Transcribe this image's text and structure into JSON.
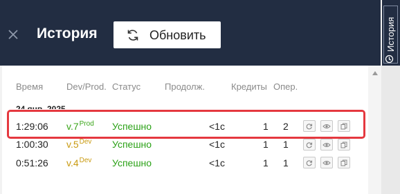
{
  "header": {
    "title": "История",
    "refresh_label": "Обновить",
    "close_icon": "close-icon",
    "refresh_icon": "refresh-icon"
  },
  "side_tab": {
    "label": "История",
    "icon": "history-icon"
  },
  "table": {
    "columns": {
      "time": "Время",
      "env": "Dev/Prod.",
      "status": "Статус",
      "duration": "Продолж.",
      "credits": "Кредиты",
      "ops": "Опер."
    },
    "date_group": "24 янв. 2025",
    "rows": [
      {
        "time": "1:29:06",
        "version": "v.7",
        "env": "Prod",
        "status": "Успешно",
        "duration": "<1c",
        "credits": "1",
        "ops": "2"
      },
      {
        "time": "1:00:30",
        "version": "v.5",
        "env": "Dev",
        "status": "Успешно",
        "duration": "<1c",
        "credits": "1",
        "ops": "1"
      },
      {
        "time": "0:51:26",
        "version": "v.4",
        "env": "Dev",
        "status": "Успешно",
        "duration": "<1c",
        "credits": "1",
        "ops": "1"
      }
    ],
    "row_actions": [
      "refresh-icon",
      "eye-icon",
      "copy-icon"
    ]
  },
  "colors": {
    "header_bg": "#222d42",
    "success": "#2aa116",
    "prod": "#3aa51a",
    "dev": "#c99a10",
    "highlight": "#e5383f"
  }
}
